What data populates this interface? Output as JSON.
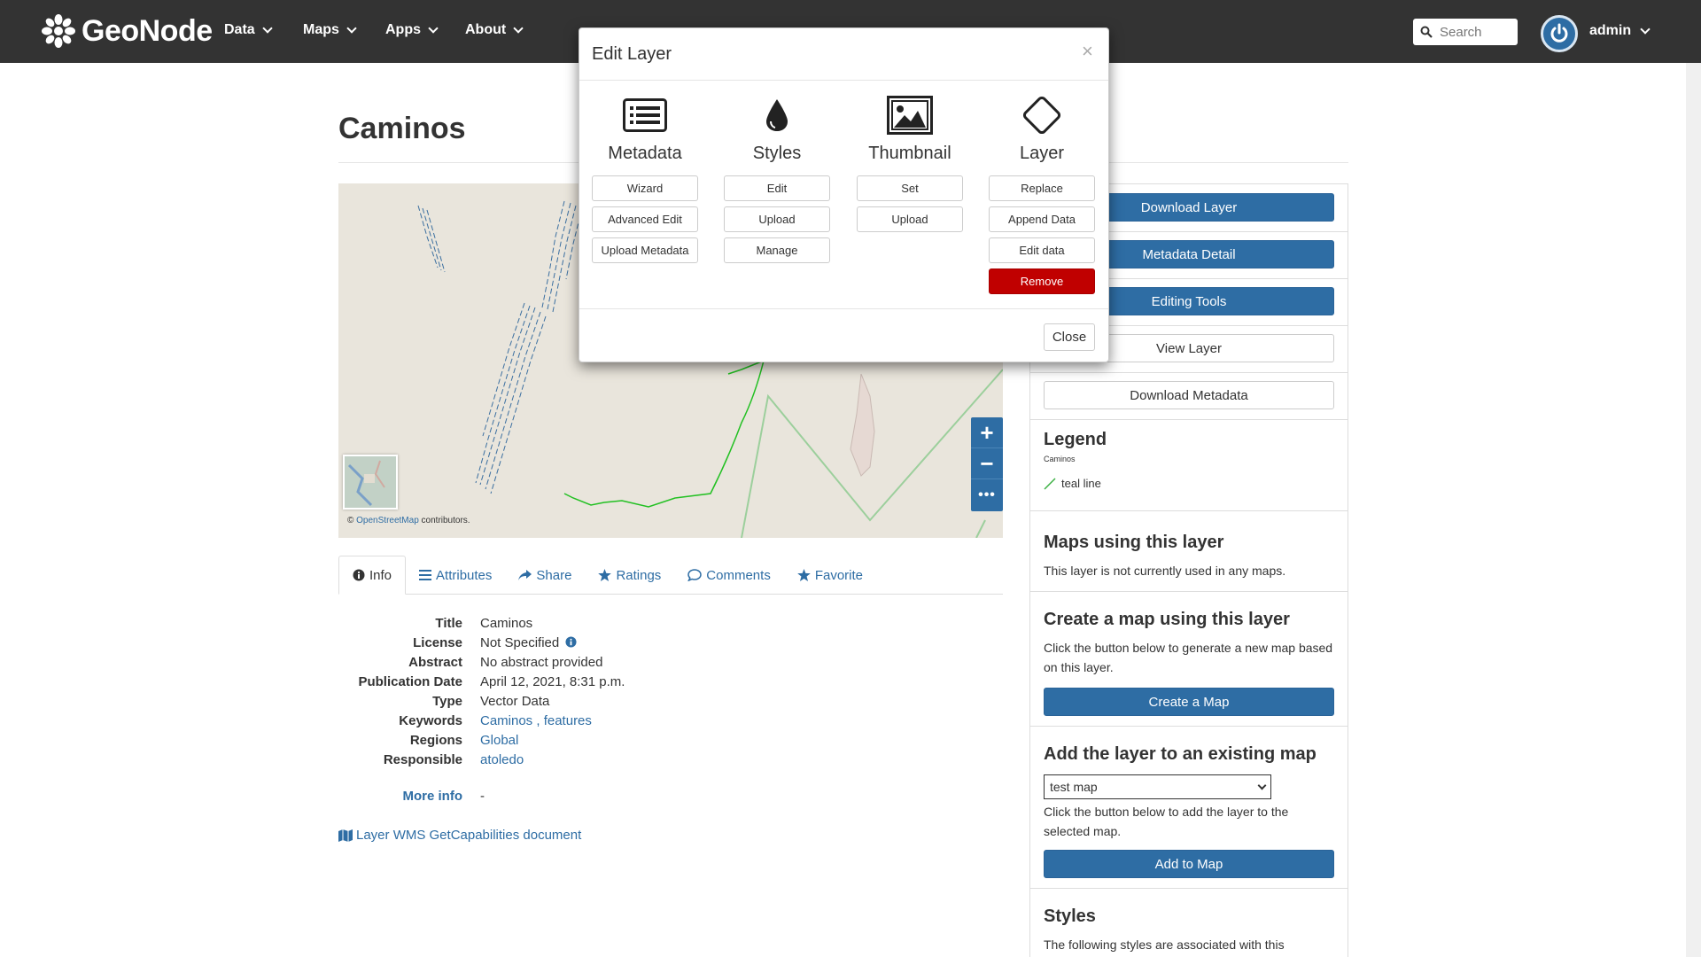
{
  "navbar": {
    "brand": "GeoNode",
    "menu": [
      {
        "label": "Data"
      },
      {
        "label": "Maps"
      },
      {
        "label": "Apps"
      },
      {
        "label": "About"
      }
    ],
    "search_placeholder": "Search",
    "user": "admin"
  },
  "page": {
    "title": "Caminos"
  },
  "map": {
    "attribution_prefix": "©",
    "attribution_link": "OpenStreetMap",
    "attribution_suffix": "contributors.",
    "zoom_in": "+",
    "zoom_out": "−",
    "more": "•••"
  },
  "tabs": [
    {
      "label": "Info",
      "icon": "info-icon"
    },
    {
      "label": "Attributes",
      "icon": "list-icon"
    },
    {
      "label": "Share",
      "icon": "share-icon"
    },
    {
      "label": "Ratings",
      "icon": "star-icon"
    },
    {
      "label": "Comments",
      "icon": "comment-icon"
    },
    {
      "label": "Favorite",
      "icon": "star-icon"
    }
  ],
  "info": {
    "title_label": "Title",
    "title_value": "Caminos",
    "license_label": "License",
    "license_value": "Not Specified",
    "abstract_label": "Abstract",
    "abstract_value": "No abstract provided",
    "pubdate_label": "Publication Date",
    "pubdate_value": "April 12, 2021, 8:31 p.m.",
    "type_label": "Type",
    "type_value": "Vector Data",
    "keywords_label": "Keywords",
    "keyword_1": "Caminos",
    "keyword_sep": ",",
    "keyword_2": "features",
    "regions_label": "Regions",
    "regions_value": "Global",
    "responsible_label": "Responsible",
    "responsible_value": "atoledo",
    "more_info_label": "More info",
    "more_info_value": "-",
    "wms_link": "Layer WMS GetCapabilities document"
  },
  "sidebar": {
    "download_layer": "Download Layer",
    "metadata_detail": "Metadata Detail",
    "editing_tools": "Editing Tools",
    "view_layer": "View Layer",
    "download_metadata": "Download Metadata",
    "legend_heading": "Legend",
    "legend_layer": "Caminos",
    "legend_item": "teal line",
    "maps_using_heading": "Maps using this layer",
    "maps_using_text": "This layer is not currently used in any maps.",
    "create_map_heading": "Create a map using this layer",
    "create_map_text": "Click the button below to generate a new map based on this layer.",
    "create_map_button": "Create a Map",
    "add_existing_heading": "Add the layer to an existing map",
    "existing_map_selected": "test map",
    "add_existing_text": "Click the button below to add the layer to the selected map.",
    "add_to_map_button": "Add to Map",
    "styles_heading": "Styles",
    "styles_text": "The following styles are associated with this"
  },
  "modal": {
    "title": "Edit Layer",
    "close_x": "×",
    "columns": [
      {
        "title": "Metadata",
        "icon": "list-icon",
        "buttons": [
          "Wizard",
          "Advanced Edit",
          "Upload Metadata"
        ]
      },
      {
        "title": "Styles",
        "icon": "droplet-icon",
        "buttons": [
          "Edit",
          "Upload",
          "Manage"
        ]
      },
      {
        "title": "Thumbnail",
        "icon": "image-icon",
        "buttons": [
          "Set",
          "Upload"
        ]
      },
      {
        "title": "Layer",
        "icon": "diamond-icon",
        "buttons": [
          "Replace",
          "Append Data",
          "Edit data",
          "Remove"
        ]
      }
    ],
    "close_button": "Close"
  },
  "colors": {
    "navbar_bg": "#333333",
    "primary": "#2e6da4",
    "danger": "#c00000",
    "legend_line": "#3cb043"
  }
}
